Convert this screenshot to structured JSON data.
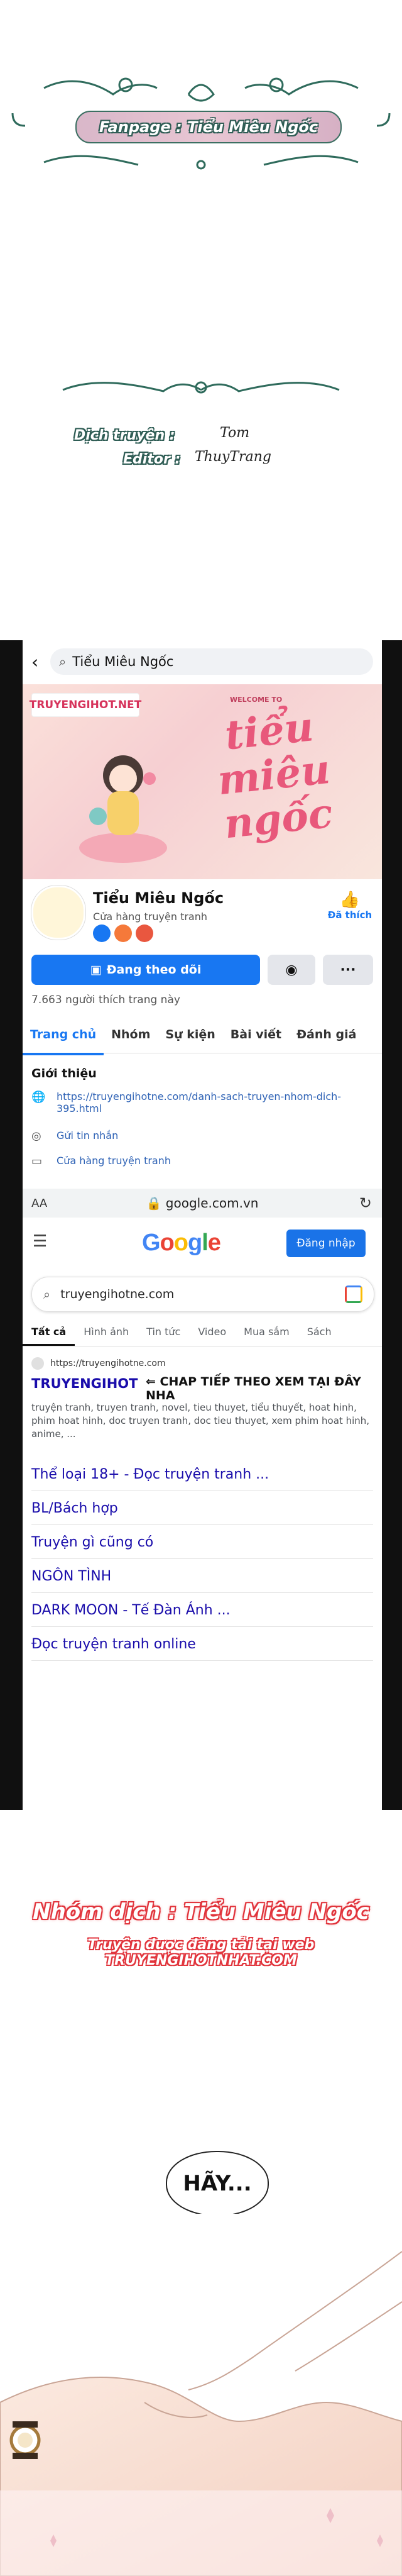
{
  "header": {
    "fanpage_label": "Fanpage : Tiểu Miêu Ngốc"
  },
  "credits": {
    "translator_label": "Dịch truyện :",
    "translator_name": "Tom",
    "editor_label": "Editor :",
    "editor_name": "ThuyTrang"
  },
  "facebook": {
    "search_query": "Tiểu Miêu Ngốc",
    "cover_site": "TRUYENGIHOT.NET",
    "cover_welcome": "WELCOME TO",
    "cover_title": "tiểu miêu ngốc",
    "page_name": "Tiểu Miêu Ngốc",
    "page_category": "Cửa hàng truyện tranh",
    "like_label": "Đã thích",
    "follow_button": "Đang theo dõi",
    "likes_count": "7.663 người thích trang này",
    "tabs": [
      "Trang chủ",
      "Nhóm",
      "Sự kiện",
      "Bài viết",
      "Đánh giá"
    ],
    "intro_title": "Giới thiệu",
    "intro_link": "https://truyengihotne.com/danh-sach-truyen-nhom-dich-395.html",
    "intro_message": "Gửi tin nhắn",
    "intro_shop": "Cửa hàng truyện tranh"
  },
  "browser": {
    "aa": "AA",
    "url": "google.com.vn"
  },
  "google": {
    "signin": "Đăng nhập",
    "query": "truyengihotne.com",
    "tabs": [
      "Tất cả",
      "Hình ảnh",
      "Tin tức",
      "Video",
      "Mua sắm",
      "Sách"
    ],
    "result_url": "https://truyengihotne.com",
    "result_title": "TRUYENGIHOT",
    "result_annotation": "⇐ CHAP TIẾP THEO XEM TẠI ĐÂY NHA",
    "result_snippet": "truyện tranh, truyen tranh, novel, tieu thuyet, tiểu thuyết, hoat hinh, phim hoat hinh, doc truyen tranh, doc tieu thuyet, xem phim hoat hinh, anime, ...",
    "sitelinks": [
      "Thể loại 18+ - Đọc truyện tranh ...",
      "BL/Bách hợp",
      "Truyện gì cũng có",
      "NGÔN TÌNH",
      "DARK MOON - Tế Đàn Ánh ...",
      "Đọc truyện tranh online"
    ]
  },
  "footer": {
    "group_line": "Nhóm dịch : Tiểu Miêu Ngốc",
    "post_line": "Truyện được đăng tải tại web TRUYENGIHOTNHAT.COM",
    "speech": "HÃY..."
  }
}
